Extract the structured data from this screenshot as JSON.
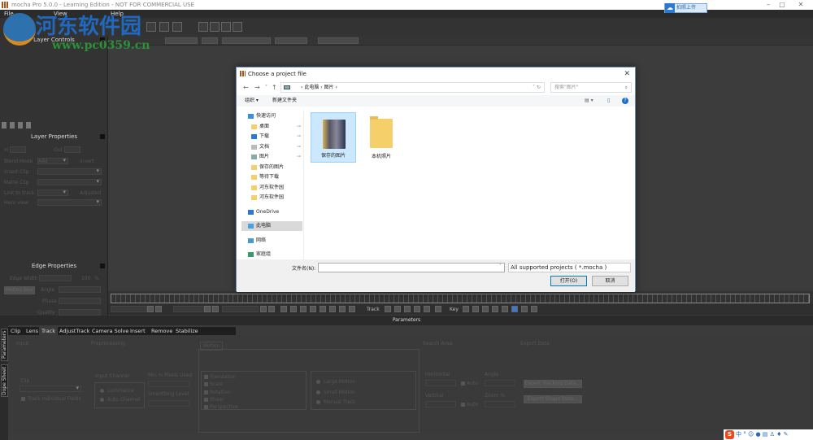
{
  "window": {
    "title": "mocha Pro 5.0.0 - Learning Edition - NOT FOR COMMERCIAL USE",
    "upload_label": "拍照上传",
    "min": "–",
    "max": "▢",
    "close": "✕"
  },
  "menu": [
    "File",
    "View",
    "Help"
  ],
  "watermark": {
    "name": "河东软件园",
    "url": "www.pc0359.cn"
  },
  "left_panel": {
    "layer_controls": "Layer Controls",
    "layer_properties": "Layer Properties",
    "in": "In",
    "out": "Out",
    "blend_mode": "Blend Mode",
    "blend_value": "Add",
    "invert": "Invert",
    "insert_clip": "Insert Clip",
    "matte_clip": "Matte Clip",
    "link_to_track": "Link to track",
    "adjusted": "Adjusted",
    "hero_view": "Hero view",
    "edge_properties": "Edge Properties",
    "edge_width": "Edge Width",
    "edge_value": "100",
    "edge_pct": "%",
    "motion_blur": "Motion Blur",
    "angle": "Angle",
    "phase": "Phase",
    "quality": "Quality"
  },
  "dialog": {
    "title": "Choose a project file",
    "path": [
      "此电脑",
      "图片"
    ],
    "search_placeholder": "搜索\"图片\"",
    "organize": "组织 ▾",
    "new_folder": "新建文件夹",
    "nav": [
      {
        "label": "快速访问",
        "icon": "star-icon",
        "pin": false
      },
      {
        "label": "桌面",
        "icon": "folder-icon",
        "pin": true
      },
      {
        "label": "下载",
        "icon": "download-icon",
        "pin": true
      },
      {
        "label": "文档",
        "icon": "document-icon",
        "pin": true
      },
      {
        "label": "图片",
        "icon": "pictures-icon",
        "pin": true
      },
      {
        "label": "保存的图片",
        "icon": "folder-icon",
        "pin": false
      },
      {
        "label": "等待下载",
        "icon": "folder-icon",
        "pin": false
      },
      {
        "label": "河东软件园",
        "icon": "folder-icon",
        "pin": false
      },
      {
        "label": "河东软件园",
        "icon": "folder-icon",
        "pin": false
      },
      {
        "label": "OneDrive",
        "icon": "cloud-icon",
        "pin": false
      },
      {
        "label": "此电脑",
        "icon": "computer-icon",
        "pin": false
      },
      {
        "label": "网络",
        "icon": "network-icon",
        "pin": false
      },
      {
        "label": "家庭组",
        "icon": "homegroup-icon",
        "pin": false
      }
    ],
    "files": [
      "保存的图片",
      "本机照片"
    ],
    "filename_label": "文件名(N):",
    "filename_value": "",
    "filetype": "All supported projects ( *.mocha )",
    "open": "打开(O)",
    "cancel": "取消"
  },
  "transport": {
    "track_label": "Track",
    "key_label": "Key"
  },
  "parameters": {
    "header": "Parameters",
    "side_tabs": [
      "Parameters",
      "Dope Sheet"
    ],
    "tabs": [
      "Clip",
      "Lens",
      "Track",
      "AdjustTrack",
      "Camera Solve",
      "Insert",
      "Remove",
      "Stabilize"
    ],
    "active_tab": "Track",
    "input": "Input",
    "clip": "Clip",
    "track_fields": "Track Individual Fields",
    "preprocessing": "Preprocessing",
    "input_channel": "Input Channel",
    "luminance": "Luminance",
    "auto_channel": "Auto Channel",
    "min_pixels": "Min % Pixels Used",
    "smoothing": "Smoothing Level",
    "motion": "Motion",
    "motion_items": [
      "Translation",
      "Scale",
      "Rotation",
      "Shear",
      "Perspective"
    ],
    "motion_modes": [
      "Large Motion",
      "Small Motion",
      "Manual Track"
    ],
    "search_area": "Search Area",
    "horizontal": "Horizontal",
    "vertical": "Vertical",
    "auto": "Auto",
    "angle": "Angle",
    "zoom": "Zoom %",
    "export_data": "Export Data",
    "export_tracking": "Export Tracking Data...",
    "export_shape": "Export Shape Data..."
  },
  "ime": {
    "brand": "S",
    "lang": "中"
  }
}
